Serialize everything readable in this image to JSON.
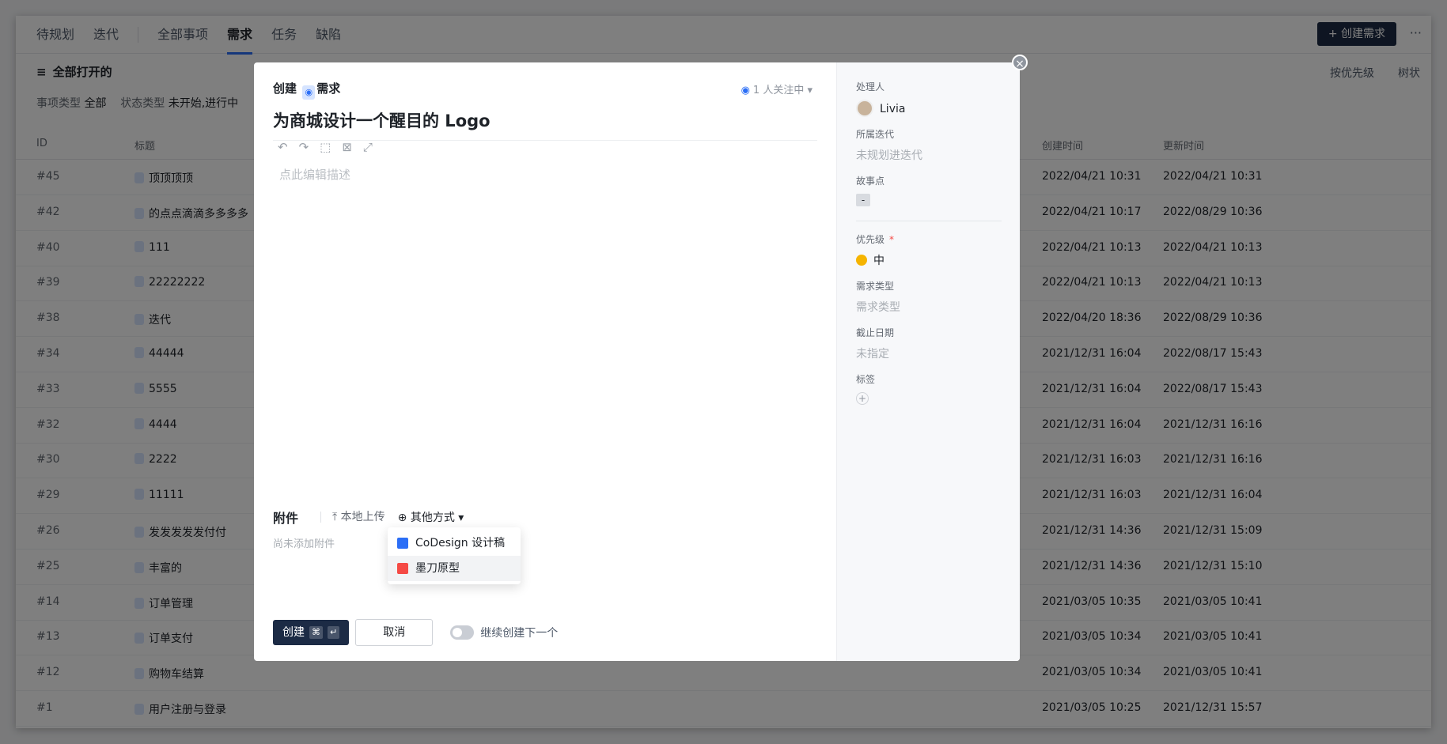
{
  "topnav": {
    "items": [
      "待规划",
      "迭代"
    ],
    "items2": [
      "全部事项",
      "需求",
      "任务",
      "缺陷"
    ],
    "active": "需求",
    "create_btn": "+ 创建需求",
    "more": "···"
  },
  "filters": {
    "all_open": "全部打开的",
    "type_label": "事项类型",
    "type_value": "全部",
    "status_label": "状态类型",
    "status_value": "未开始,进行中"
  },
  "tools": {
    "sort": "按优先级",
    "view": "树状"
  },
  "table": {
    "headers": {
      "id": "ID",
      "title": "标题",
      "created": "创建时间",
      "updated": "更新时间"
    },
    "rows": [
      {
        "id": "#45",
        "title": "顶顶顶顶",
        "created": "2022/04/21 10:31",
        "updated": "2022/04/21 10:31"
      },
      {
        "id": "#42",
        "title": "的点点滴滴多多多多",
        "created": "2022/04/21 10:17",
        "updated": "2022/08/29 10:36"
      },
      {
        "id": "#40",
        "title": "111",
        "created": "2022/04/21 10:13",
        "updated": "2022/04/21 10:13"
      },
      {
        "id": "#39",
        "title": "22222222",
        "created": "2022/04/21 10:13",
        "updated": "2022/04/21 10:13"
      },
      {
        "id": "#38",
        "title": "迭代",
        "created": "2022/04/20 18:36",
        "updated": "2022/08/29 10:36"
      },
      {
        "id": "#34",
        "title": "44444",
        "created": "2021/12/31 16:04",
        "updated": "2022/08/17 15:43"
      },
      {
        "id": "#33",
        "title": "5555",
        "created": "2021/12/31 16:04",
        "updated": "2022/08/17 15:43"
      },
      {
        "id": "#32",
        "title": "4444",
        "created": "2021/12/31 16:04",
        "updated": "2021/12/31 16:16"
      },
      {
        "id": "#30",
        "title": "2222",
        "created": "2021/12/31 16:03",
        "updated": "2021/12/31 16:16"
      },
      {
        "id": "#29",
        "title": "11111",
        "created": "2021/12/31 16:03",
        "updated": "2021/12/31 16:04"
      },
      {
        "id": "#26",
        "title": "发发发发发付付",
        "created": "2021/12/31 14:36",
        "updated": "2021/12/31 15:09"
      },
      {
        "id": "#25",
        "title": "丰富的",
        "created": "2021/12/31 14:36",
        "updated": "2021/12/31 15:10"
      },
      {
        "id": "#14",
        "title": "订单管理",
        "created": "2021/03/05 10:35",
        "updated": "2021/03/05 10:41"
      },
      {
        "id": "#13",
        "title": "订单支付",
        "created": "2021/03/05 10:34",
        "updated": "2021/03/05 10:41"
      },
      {
        "id": "#12",
        "title": "购物车结算",
        "created": "2021/03/05 10:34",
        "updated": "2021/03/05 10:41"
      },
      {
        "id": "#1",
        "title": "用户注册与登录",
        "created": "2021/03/05 10:25",
        "updated": "2021/12/31 15:57"
      }
    ]
  },
  "modal": {
    "head_create": "创建",
    "head_type": "需求",
    "watch": "1 人关注中",
    "title": "为商城设计一个醒目的 Logo",
    "desc_placeholder": "点此编辑描述",
    "attach_label": "附件",
    "local_upload": "本地上传",
    "other_way": "其他方式",
    "no_attach": "尚未添加附件",
    "dropdown": [
      "CoDesign 设计稿",
      "墨刀原型"
    ],
    "create_btn": "创建",
    "cancel_btn": "取消",
    "continue": "继续创建下一个"
  },
  "side": {
    "assignee_label": "处理人",
    "assignee": "Livia",
    "iter_label": "所属迭代",
    "iter": "未规划进迭代",
    "points_label": "故事点",
    "points": "-",
    "priority_label": "优先级",
    "priority": "中",
    "reqtype_label": "需求类型",
    "reqtype": "需求类型",
    "due_label": "截止日期",
    "due": "未指定",
    "tags_label": "标签"
  }
}
